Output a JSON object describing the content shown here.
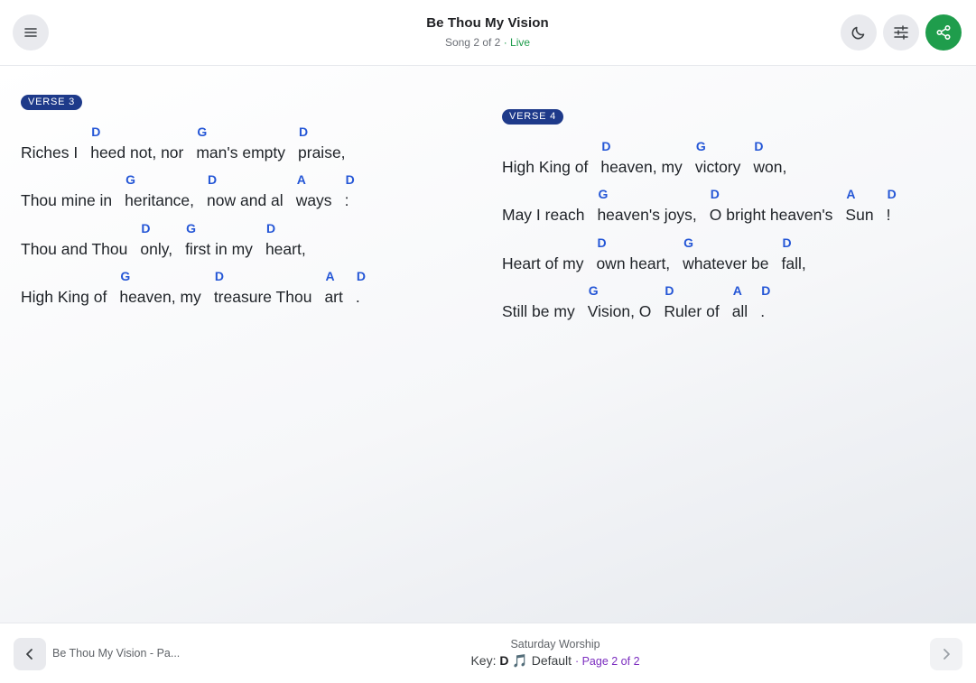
{
  "header": {
    "title": "Be Thou My Vision",
    "subtitle": "Song 2 of 2",
    "status": "· Live",
    "icons": {
      "menu": "hamburger-icon",
      "theme": "moon-icon",
      "settings": "sliders-icon",
      "share": "share-icon"
    },
    "share_color": "#1f9d4c",
    "status_color": "#1f9d4c"
  },
  "verses": [
    {
      "label": "VERSE 3",
      "lines": [
        [
          {
            "chord": "",
            "lyric": "Riches I"
          },
          {
            "chord": "D",
            "lyric": "heed not, nor"
          },
          {
            "chord": "G",
            "lyric": "man's empty"
          },
          {
            "chord": "D",
            "lyric": "praise,"
          }
        ],
        [
          {
            "chord": "",
            "lyric": "Thou mine in"
          },
          {
            "chord": "G",
            "lyric": "heritance,"
          },
          {
            "chord": "D",
            "lyric": "now and al"
          },
          {
            "chord": "A",
            "lyric": "ways"
          },
          {
            "chord": "D",
            "lyric": ":"
          }
        ],
        [
          {
            "chord": "",
            "lyric": "Thou and Thou"
          },
          {
            "chord": "D",
            "lyric": "only,"
          },
          {
            "chord": "G",
            "lyric": "first in my"
          },
          {
            "chord": "D",
            "lyric": "heart,"
          }
        ],
        [
          {
            "chord": "",
            "lyric": "High King of"
          },
          {
            "chord": "G",
            "lyric": "heaven, my"
          },
          {
            "chord": "D",
            "lyric": "treasure Thou"
          },
          {
            "chord": "A",
            "lyric": "art"
          },
          {
            "chord": "D",
            "lyric": "."
          }
        ]
      ]
    },
    {
      "label": "VERSE 4",
      "lines": [
        [
          {
            "chord": "",
            "lyric": "High King of"
          },
          {
            "chord": "D",
            "lyric": "heaven, my"
          },
          {
            "chord": "G",
            "lyric": "victory"
          },
          {
            "chord": "D",
            "lyric": "won,"
          }
        ],
        [
          {
            "chord": "",
            "lyric": "May I reach"
          },
          {
            "chord": "G",
            "lyric": "heaven's joys,"
          },
          {
            "chord": "D",
            "lyric": "O bright heaven's"
          },
          {
            "chord": "A",
            "lyric": "Sun"
          },
          {
            "chord": "D",
            "lyric": "!"
          }
        ],
        [
          {
            "chord": "",
            "lyric": "Heart of my"
          },
          {
            "chord": "D",
            "lyric": "own heart,"
          },
          {
            "chord": "G",
            "lyric": "whatever be"
          },
          {
            "chord": "D",
            "lyric": "fall,"
          }
        ],
        [
          {
            "chord": "",
            "lyric": "Still be my"
          },
          {
            "chord": "G",
            "lyric": "Vision, O"
          },
          {
            "chord": "D",
            "lyric": "Ruler of"
          },
          {
            "chord": "A",
            "lyric": "all"
          },
          {
            "chord": "D",
            "lyric": "."
          }
        ]
      ]
    }
  ],
  "colors": {
    "chord": "#2456d6",
    "badge": "#1e3a8a",
    "page_info": "#7b2cbf"
  },
  "footer": {
    "prev_label": "Be Thou My Vision - Pa...",
    "set_name": "Saturday Worship",
    "key_prefix": "Key:",
    "key_value": "D",
    "note_glyph": "🎵",
    "arrangement": "Default",
    "page_info": "· Page 2 of 2",
    "icons": {
      "prev": "chevron-left-icon",
      "next": "chevron-right-icon"
    }
  }
}
